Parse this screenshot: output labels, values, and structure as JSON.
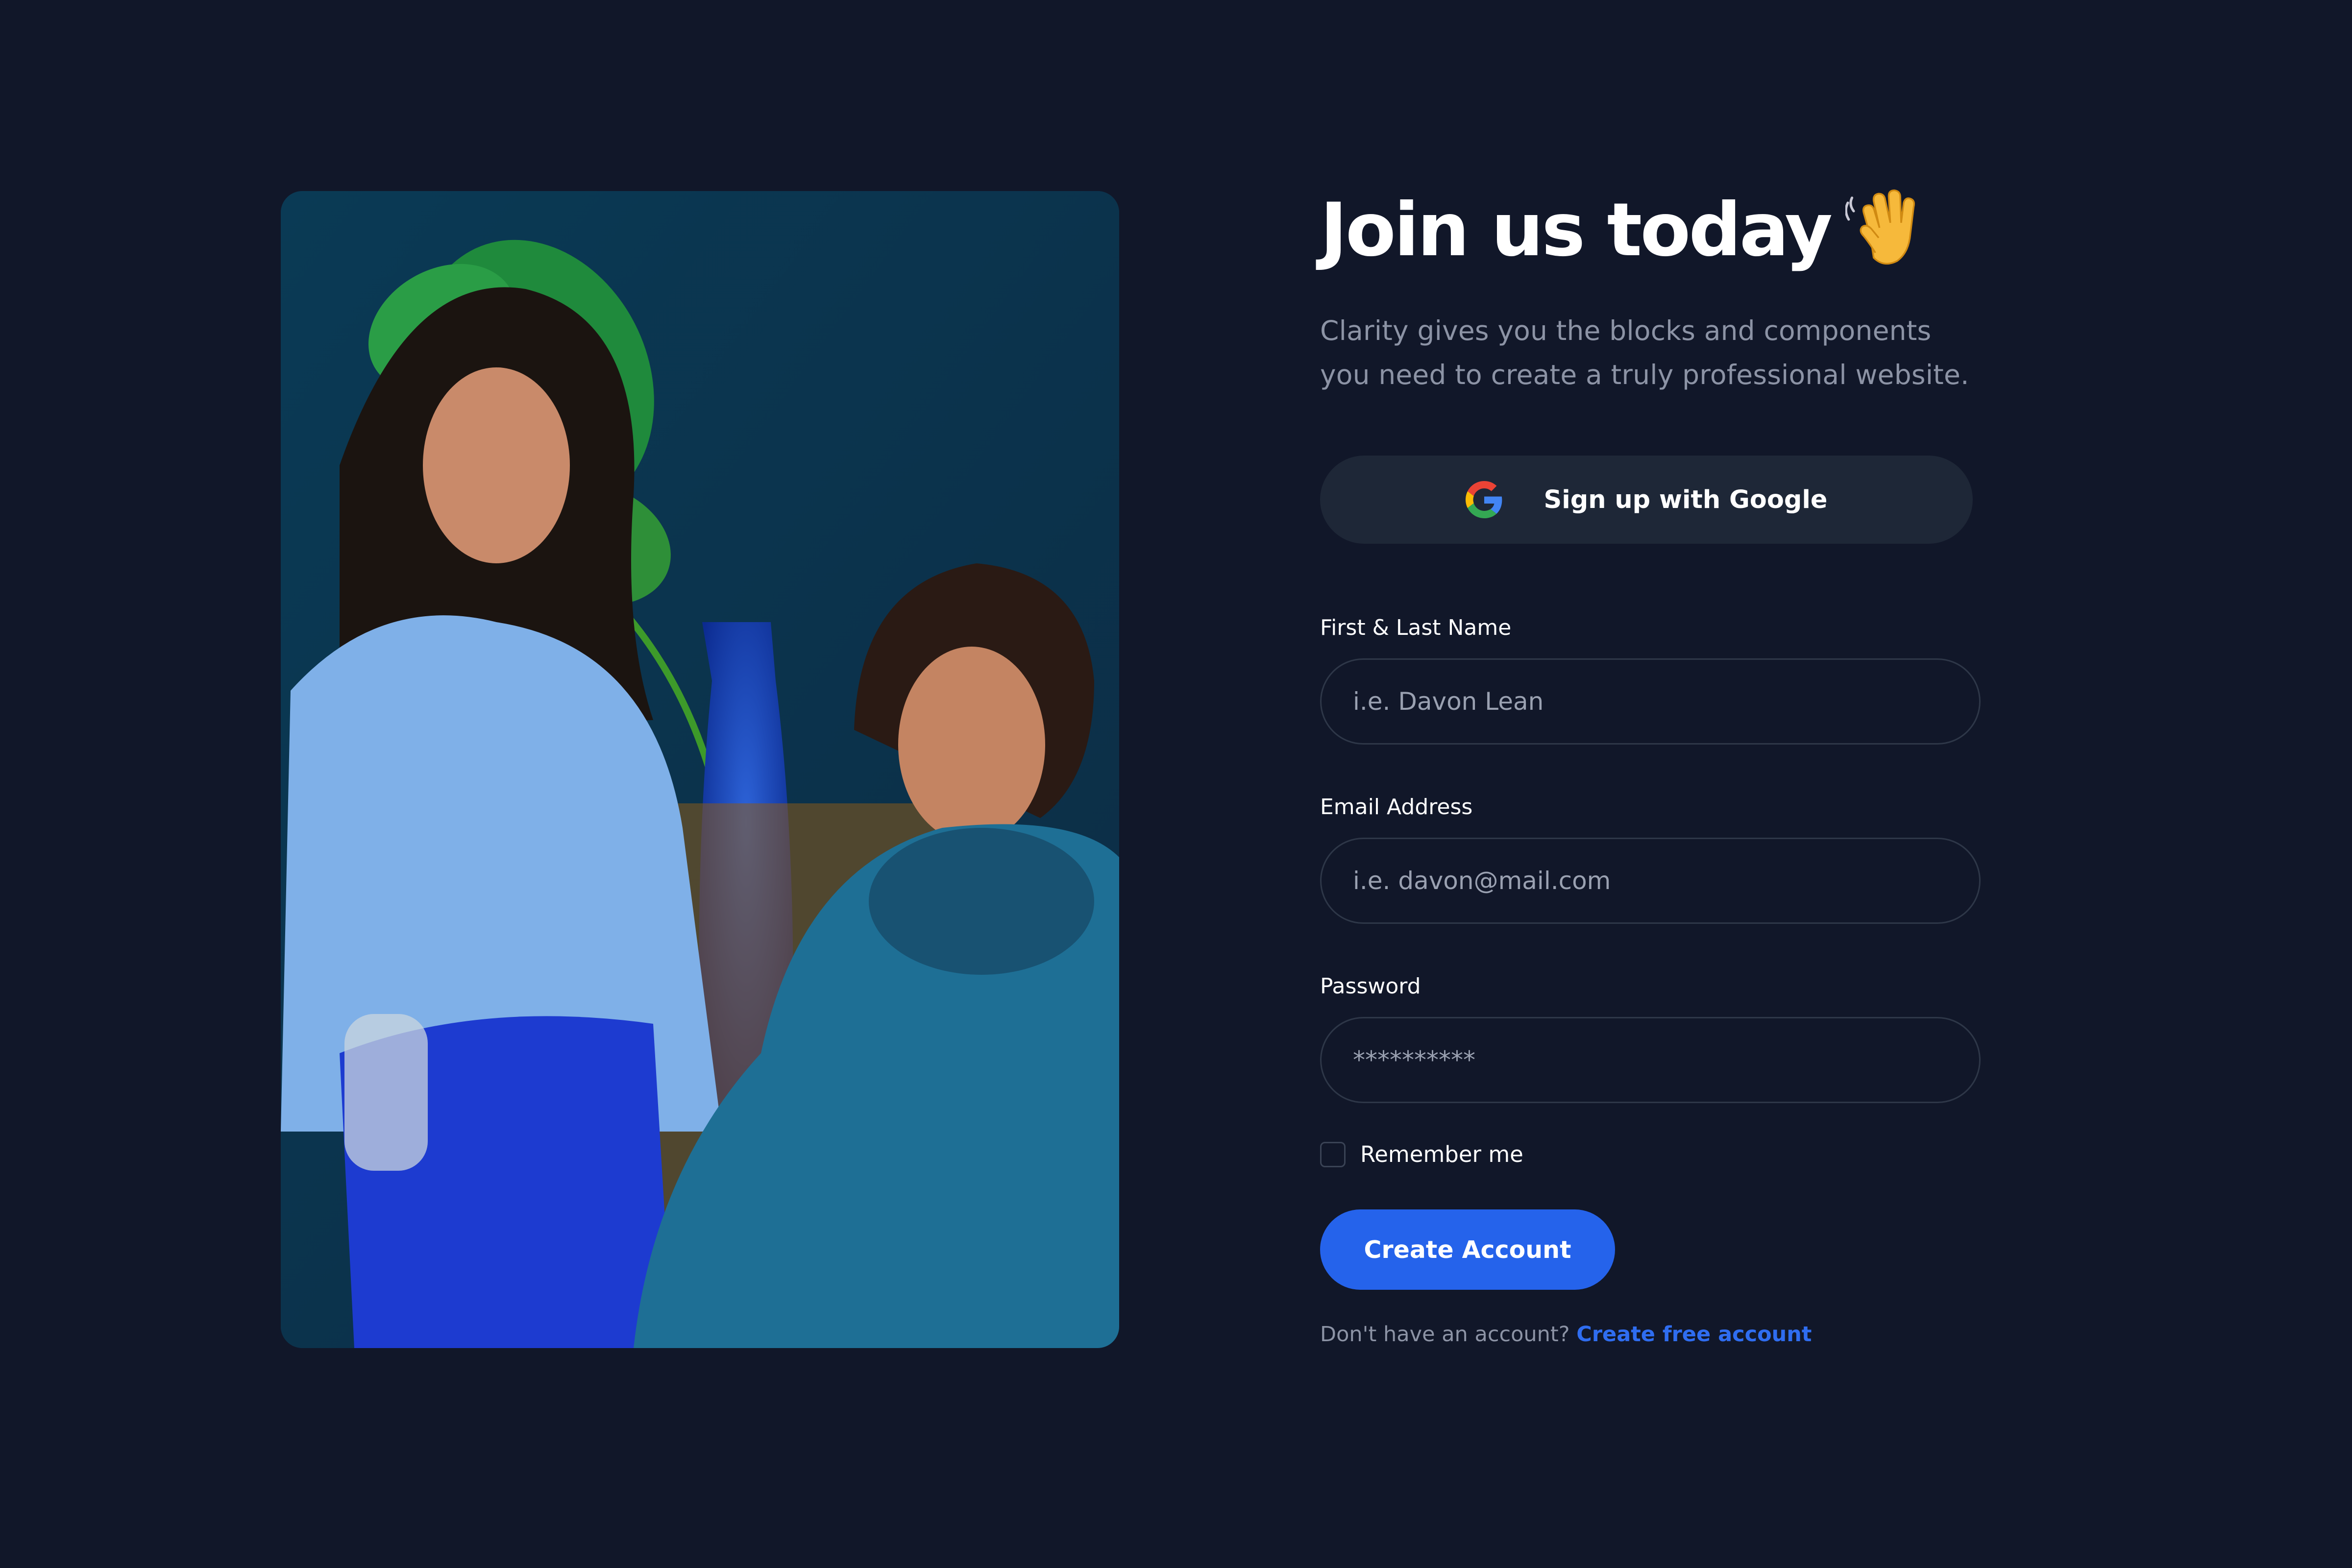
{
  "header": {
    "title": "Join us today",
    "title_icon": "waving-hand-icon",
    "subtitle": "Clarity gives you the blocks and components you need to create a truly professional website."
  },
  "google_signup": {
    "label": "Sign up with Google",
    "icon": "google-logo-icon"
  },
  "form": {
    "name": {
      "label": "First & Last Name",
      "placeholder": "i.e. Davon Lean",
      "value": ""
    },
    "email": {
      "label": "Email Address",
      "placeholder": "i.e. davon@mail.com",
      "value": ""
    },
    "password": {
      "label": "Password",
      "placeholder": "**********",
      "value": ""
    },
    "remember": {
      "label": "Remember me",
      "checked": false
    },
    "submit_label": "Create Account"
  },
  "footer": {
    "prompt": "Don't have an account?",
    "link_label": "Create free account"
  },
  "colors": {
    "background": "#111729",
    "accent": "#2563eb",
    "link": "#2f6df0",
    "muted_text": "#8c93a5",
    "button_dark": "#1e2737"
  }
}
